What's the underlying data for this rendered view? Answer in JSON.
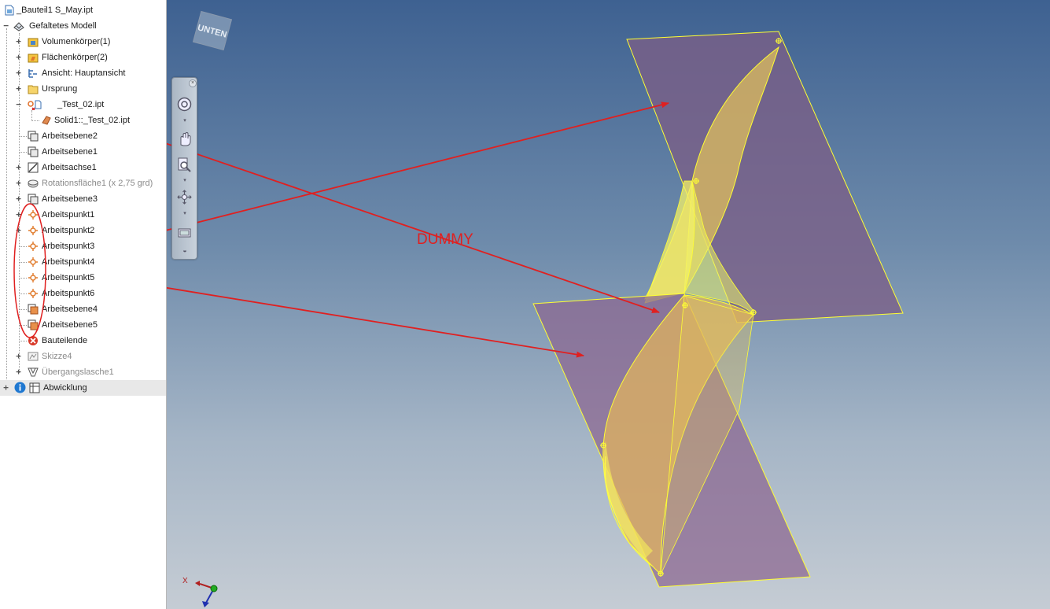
{
  "browser": {
    "items": [
      {
        "label": "_Bauteil1 S_May.ipt",
        "icon": "part-file-icon"
      },
      {
        "label": "Gefaltetes Modell",
        "icon": "folded-model-icon"
      },
      {
        "label": "Volumenkörper(1)",
        "icon": "solid-bodies-folder-icon"
      },
      {
        "label": "Flächenkörper(2)",
        "icon": "surface-bodies-folder-icon"
      },
      {
        "label": "Ansicht: Hauptansicht",
        "icon": "view-representation-icon"
      },
      {
        "label": "Ursprung",
        "icon": "origin-folder-icon"
      },
      {
        "label": "_Test_02.ipt",
        "icon": "derived-part-broken-link-icon"
      },
      {
        "label": "Solid1::_Test_02.ipt",
        "icon": "solid-body-icon"
      },
      {
        "label": "Arbeitsebene2",
        "icon": "work-plane-icon"
      },
      {
        "label": "Arbeitsebene1",
        "icon": "work-plane-icon"
      },
      {
        "label": "Arbeitsachse1",
        "icon": "work-axis-icon"
      },
      {
        "label": "Rotationsfläche1 (x 2,75 grd)",
        "icon": "revolve-icon"
      },
      {
        "label": "Arbeitsebene3",
        "icon": "work-plane-icon"
      },
      {
        "label": "Arbeitspunkt1",
        "icon": "work-point-icon"
      },
      {
        "label": "Arbeitspunkt2",
        "icon": "work-point-icon"
      },
      {
        "label": "Arbeitspunkt3",
        "icon": "work-point-icon"
      },
      {
        "label": "Arbeitspunkt4",
        "icon": "work-point-icon"
      },
      {
        "label": "Arbeitspunkt5",
        "icon": "work-point-icon"
      },
      {
        "label": "Arbeitspunkt6",
        "icon": "work-point-icon"
      },
      {
        "label": "Arbeitsebene4",
        "icon": "work-plane-orange-icon"
      },
      {
        "label": "Arbeitsebene5",
        "icon": "work-plane-orange-icon"
      },
      {
        "label": "Bauteilende",
        "icon": "end-of-part-icon"
      },
      {
        "label": "Skizze4",
        "icon": "sketch-icon"
      },
      {
        "label": "Übergangslasche1",
        "icon": "lofted-flange-icon"
      },
      {
        "label": "Abwicklung",
        "icon": "flat-pattern-icon"
      }
    ]
  },
  "viewport": {
    "viewcube_label": "UNTEN",
    "annotation": "DUMMY",
    "axis_x_label": "X"
  },
  "colors": {
    "annotation_red": "#e02020",
    "plane_fill": "#7b5f86",
    "plane_edge": "#ffff33",
    "surface_fill": "#e8c35c",
    "bg_top": "#3e6191",
    "bg_bottom": "#c5ccd4"
  }
}
